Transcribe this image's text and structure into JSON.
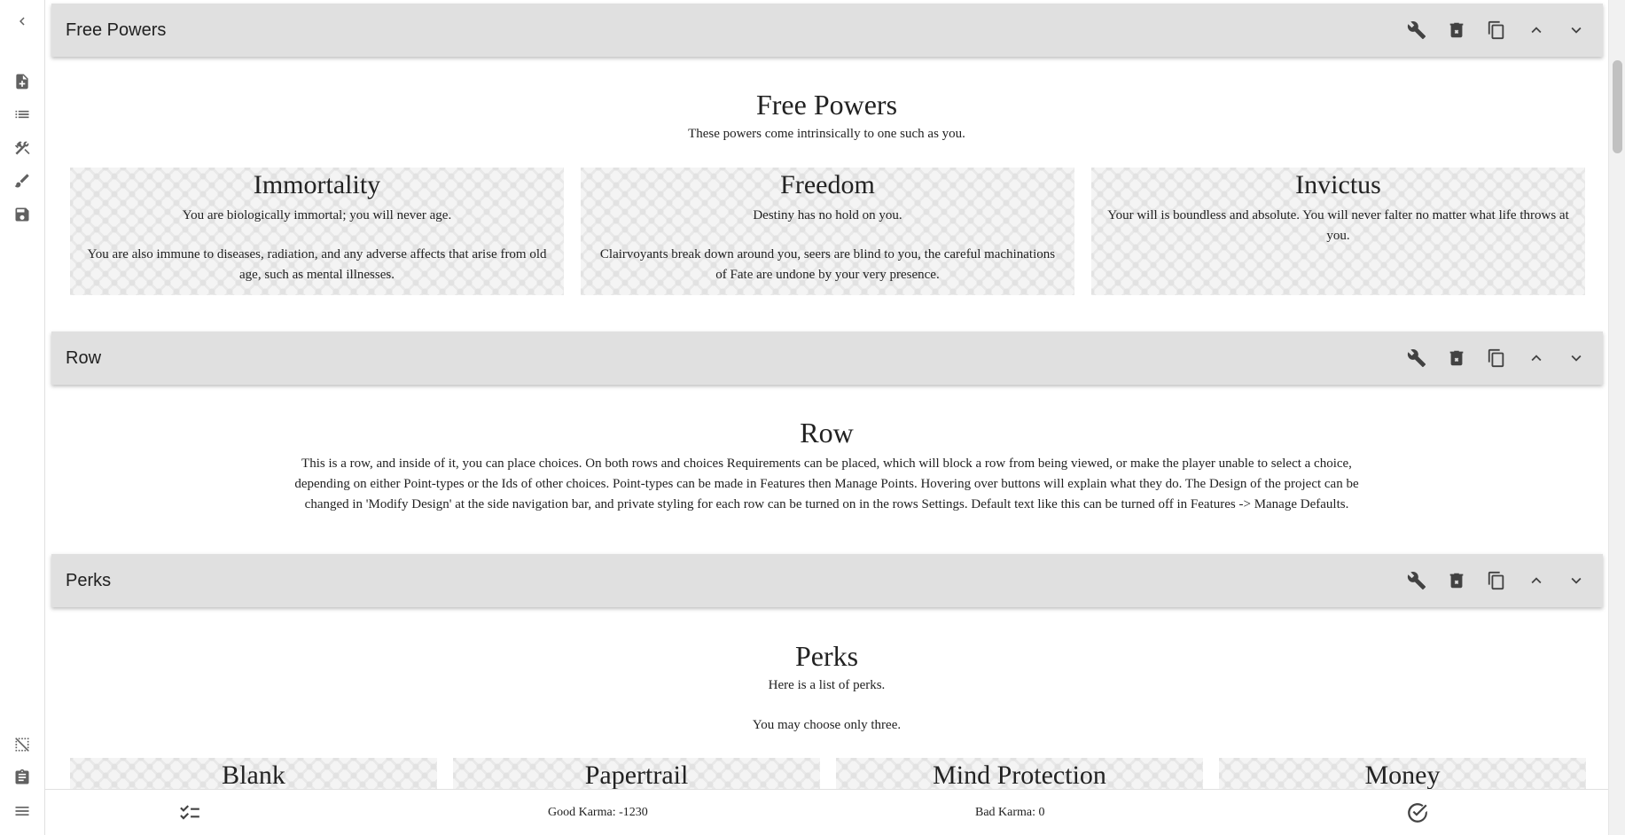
{
  "sidebar": {
    "icons": [
      "chevron-left-icon",
      "note-add-icon",
      "list-icon",
      "tools-icon",
      "brush-icon",
      "save-icon",
      "grid-off-icon",
      "clipboard-icon",
      "menu-icon"
    ]
  },
  "rows": [
    {
      "toolbar_title": "Free Powers",
      "title": "Free Powers",
      "text": "These powers come intrinsically to one such as you.",
      "choices": [
        {
          "title": "Immortality",
          "paragraphs": [
            "You are biologically immortal; you will never age.",
            "You are also immune to diseases, radiation, and any adverse affects that arise from old age, such as mental illnesses."
          ]
        },
        {
          "title": "Freedom",
          "paragraphs": [
            "Destiny has no hold on you.",
            "Clairvoyants break down around you, seers are blind to you, the careful machinations of Fate are undone by your very presence."
          ]
        },
        {
          "title": "Invictus",
          "paragraphs": [
            "Your will is boundless and absolute. You will never falter no matter what life throws at you."
          ]
        }
      ]
    },
    {
      "toolbar_title": "Row",
      "title": "Row",
      "text": "This is a row, and inside of it, you can place choices. On both rows and choices Requirements can be placed, which will block a row from being viewed, or make the player unable to select a choice, depending on either Point-types or the Ids of other choices. Point-types can be made in Features then Manage Points. Hovering over buttons will explain what they do. The Design of the project can be changed in 'Modify Design' at the side navigation bar, and private styling for each row can be turned on in the rows Settings. Default text like this can be turned off in Features -> Manage Defaults."
    },
    {
      "toolbar_title": "Perks",
      "title": "Perks",
      "text1": "Here is a list of perks.",
      "text2": "You may choose only three.",
      "choices": [
        {
          "title": "Blank"
        },
        {
          "title": "Papertrail"
        },
        {
          "title": "Mind Protection"
        },
        {
          "title": "Money"
        }
      ]
    }
  ],
  "bottom_bar": {
    "good_karma": "Good Karma: -1230",
    "bad_karma": "Bad Karma: 0"
  }
}
